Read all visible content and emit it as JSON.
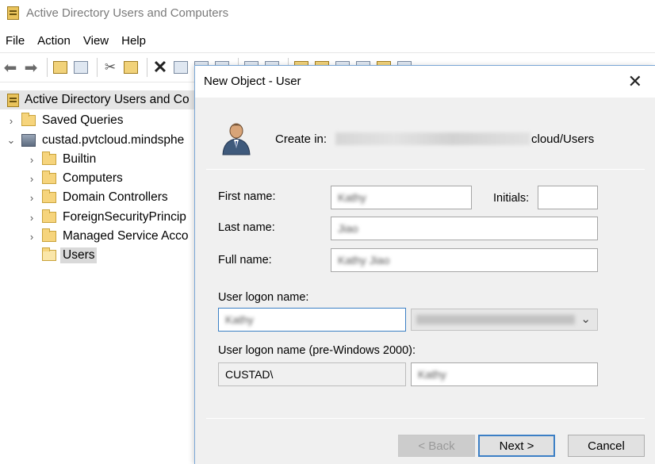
{
  "window": {
    "title": "Active Directory Users and Computers"
  },
  "menu": [
    "File",
    "Action",
    "View",
    "Help"
  ],
  "toolbar": {
    "icons": [
      "back-arrow-icon",
      "forward-arrow-icon",
      "folder-up-icon",
      "show-hide-tree-icon",
      "cut-icon",
      "clipboard-icon",
      "delete-icon",
      "properties-icon",
      "refresh-icon",
      "export-list-icon",
      "help-icon",
      "console-icon",
      "new-user-icon",
      "new-group-icon",
      "new-ou-icon",
      "filter-icon",
      "find-icon",
      "add-to-group-icon"
    ]
  },
  "tree": {
    "root": "Active Directory Users and Co",
    "saved_queries": "Saved Queries",
    "domain": "custad.pvtcloud.mindsphe",
    "children": [
      {
        "label": "Builtin",
        "expandable": true
      },
      {
        "label": "Computers",
        "expandable": true
      },
      {
        "label": "Domain Controllers",
        "expandable": true
      },
      {
        "label": "ForeignSecurityPrincip",
        "expandable": true
      },
      {
        "label": "Managed Service Acco",
        "expandable": true
      },
      {
        "label": "Users",
        "expandable": false,
        "selected": true
      }
    ]
  },
  "dialog": {
    "title": "New Object - User",
    "close": "✕",
    "create_in_label": "Create in:",
    "create_in_suffix": "cloud/Users",
    "first_name_label": "First name:",
    "first_name_value": "Kathy",
    "initials_label": "Initials:",
    "initials_value": "",
    "last_name_label": "Last name:",
    "last_name_value": "Jiao",
    "full_name_label": "Full name:",
    "full_name_value": "Kathy Jiao",
    "logon_label": "User logon name:",
    "logon_value": "Kathy",
    "pre2000_label": "User logon name (pre-Windows 2000):",
    "pre2000_domain": "CUSTAD\\",
    "pre2000_value": "Kathy",
    "back_label": "< Back",
    "next_label": "Next >",
    "cancel_label": "Cancel"
  }
}
